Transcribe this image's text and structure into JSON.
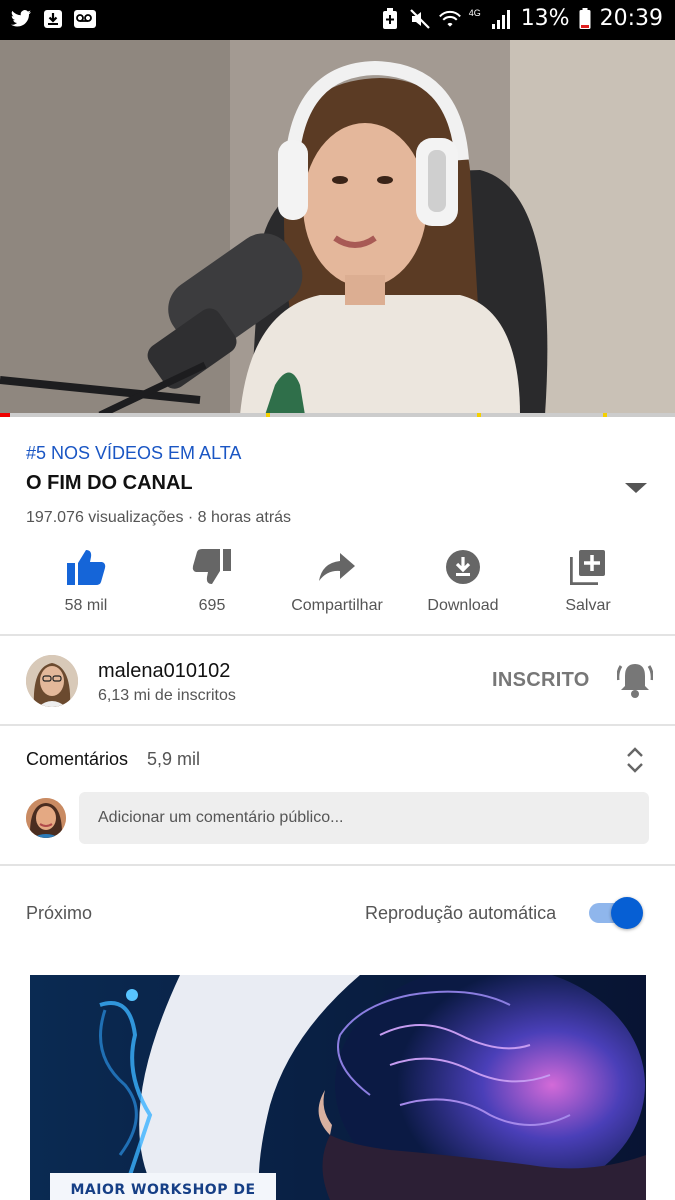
{
  "status_bar": {
    "battery": "13%",
    "time": "20:39",
    "network": "4G",
    "left_icons": [
      "twitter-icon",
      "download-notification-icon",
      "voicemail-icon"
    ],
    "right_icons": [
      "battery-saver-icon",
      "mute-icon",
      "wifi-icon",
      "signal-icon",
      "battery-icon"
    ]
  },
  "video": {
    "progress_fraction": 0.015
  },
  "info": {
    "trending": "#5 NOS VÍDEOS EM ALTA",
    "title": "O FIM DO CANAL",
    "meta": "197.076 visualizações · 8 horas atrás"
  },
  "actions": {
    "like": "58 mil",
    "dislike": "695",
    "share": "Compartilhar",
    "download": "Download",
    "save": "Salvar"
  },
  "channel": {
    "name": "malena010102",
    "subscribers": "6,13 mi de inscritos",
    "subscribed_label": "INSCRITO"
  },
  "comments": {
    "title": "Comentários",
    "count": "5,9 mil",
    "placeholder": "Adicionar um comentário público..."
  },
  "up_next": {
    "label": "Próximo",
    "autoplay_label": "Reprodução automática",
    "autoplay_on": true,
    "thumbnail_text": "MAIOR WORKSHOP DE"
  },
  "colors": {
    "accent_blue": "#065fd4",
    "trending_blue": "#1a56c4",
    "like_blue": "#1565d8",
    "progress_red": "#e00000"
  }
}
